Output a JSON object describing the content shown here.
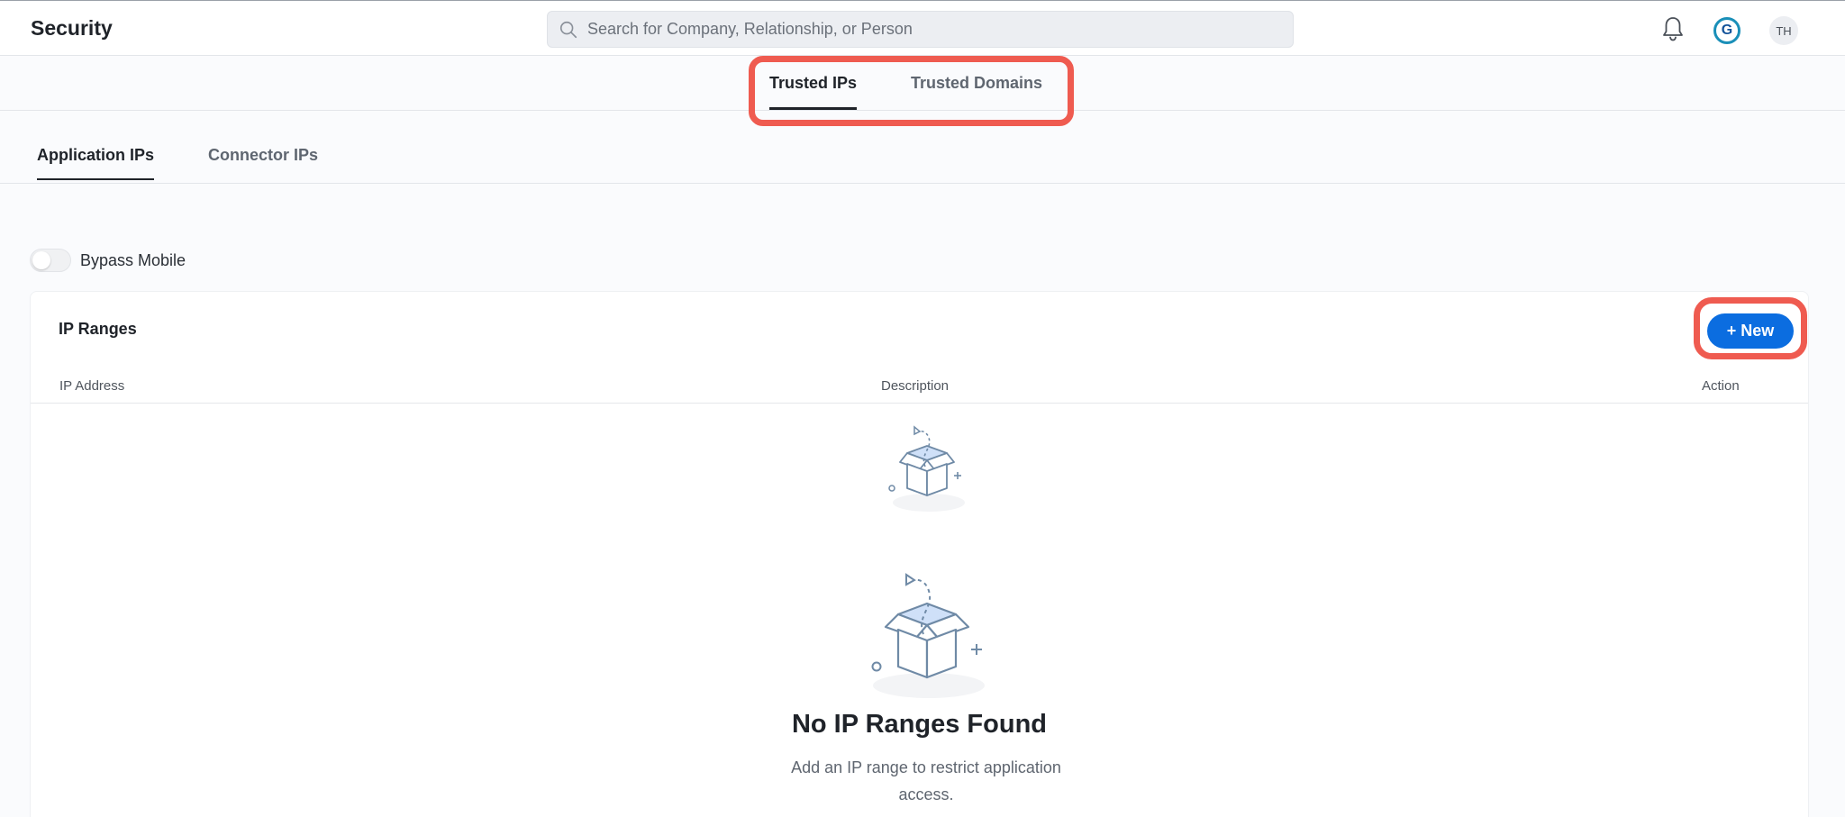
{
  "header": {
    "title": "Security",
    "search_placeholder": "Search for Company, Relationship, or Person",
    "user_initials": "TH",
    "brand_initial": "G"
  },
  "main_tabs": [
    {
      "label": "Trusted IPs",
      "active": true
    },
    {
      "label": "Trusted Domains",
      "active": false
    }
  ],
  "sub_tabs": [
    {
      "label": "Application IPs",
      "active": true
    },
    {
      "label": "Connector IPs",
      "active": false
    }
  ],
  "bypass": {
    "label": "Bypass Mobile",
    "enabled": false
  },
  "ip_ranges": {
    "title": "IP Ranges",
    "new_button": "+ New",
    "columns": [
      "IP Address",
      "Description",
      "Action"
    ],
    "empty_title": "No IP Ranges Found",
    "empty_description": "Add an IP range to restrict application access."
  },
  "colors": {
    "accent": "#0b6de0",
    "highlight": "#ef5b50"
  },
  "icons": [
    "search-icon",
    "bell-icon",
    "empty-box-icon"
  ]
}
